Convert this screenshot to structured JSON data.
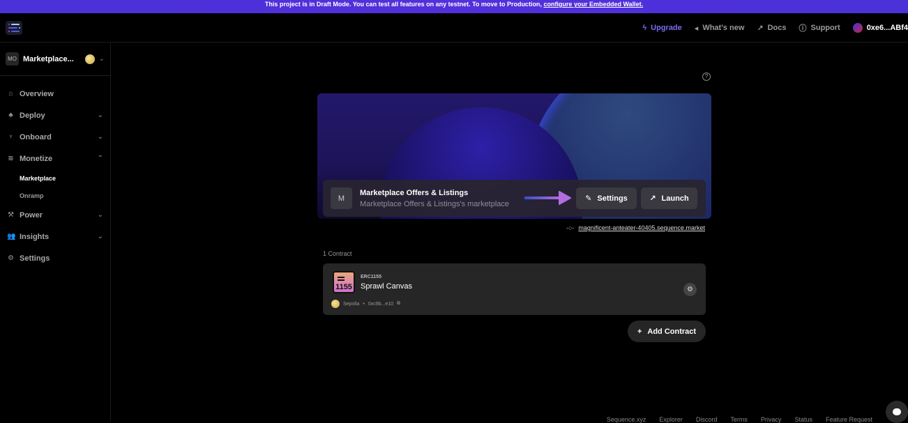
{
  "banner": {
    "text": "This project is in Draft Mode. You can test all features on any testnet. To move to Production, ",
    "link": "configure your Embedded Wallet."
  },
  "topbar": {
    "upgrade": "Upgrade",
    "whats_new": "What's new",
    "docs": "Docs",
    "support": "Support",
    "account": "0xe6...ABf4"
  },
  "sidebar": {
    "project_initials": "MO",
    "project_name": "Marketplace...",
    "items": [
      {
        "label": "Overview",
        "icon": "home-icon"
      },
      {
        "label": "Deploy",
        "icon": "cubes-icon"
      },
      {
        "label": "Onboard",
        "icon": "parachute-icon"
      },
      {
        "label": "Monetize",
        "icon": "coins-icon"
      },
      {
        "label": "Power",
        "icon": "power-icon"
      },
      {
        "label": "Insights",
        "icon": "users-icon"
      },
      {
        "label": "Settings",
        "icon": "gear-icon"
      }
    ],
    "monetize_sub": [
      "Marketplace",
      "Onramp"
    ]
  },
  "marketplace": {
    "initial": "M",
    "title": "Marketplace Offers & Listings",
    "subtitle": "Marketplace Offers & Listings's marketplace",
    "settings_label": "Settings",
    "launch_label": "Launch",
    "domain": "magnificent-anteater-40405.sequence.market"
  },
  "contracts": {
    "count_label": "1 Contract",
    "items": [
      {
        "standard": "ERC1155",
        "icon_text": "1155",
        "name": "Sprawl Canvas",
        "network": "Sepolia",
        "address": "0xc9b...e10"
      }
    ],
    "add_label": "Add Contract"
  },
  "footer": [
    "Sequence.xyz",
    "Explorer",
    "Discord",
    "Terms",
    "Privacy",
    "Status",
    "Feature Request"
  ],
  "colors": {
    "accent": "#7a6cf2",
    "banner": "#4a31d8"
  }
}
